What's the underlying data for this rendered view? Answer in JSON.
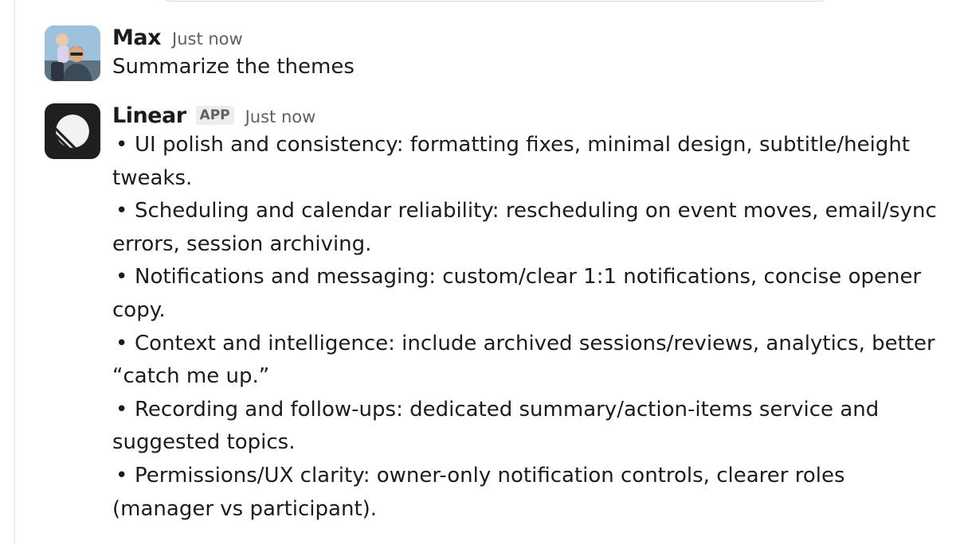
{
  "messages": [
    {
      "sender": "Max",
      "timestamp": "Just now",
      "text": "Summarize the themes"
    },
    {
      "sender": "Linear",
      "badge": "APP",
      "timestamp": "Just now",
      "bullets": [
        "UI polish and consistency: formatting fixes, minimal design, subtitle/height tweaks.",
        "Scheduling and calendar reliability: rescheduling on event moves, email/sync errors, session archiving.",
        "Notifications and messaging: custom/clear 1:1 notifications, concise opener copy.",
        "Context and intelligence: include archived sessions/reviews, analytics, better “catch me up.”",
        "Recording and follow-ups: dedicated summary/action-items service and suggested topics.",
        "Permissions/UX clarity: owner-only notification controls, clearer roles (manager vs participant)."
      ]
    }
  ],
  "icons": {
    "user_avatar": "user-avatar-photo",
    "app_avatar": "linear-logo-icon"
  },
  "colors": {
    "text": "#1d1c1d",
    "muted": "#616061",
    "badge_bg": "#ededed",
    "linear_bg": "#1f1f1f"
  }
}
